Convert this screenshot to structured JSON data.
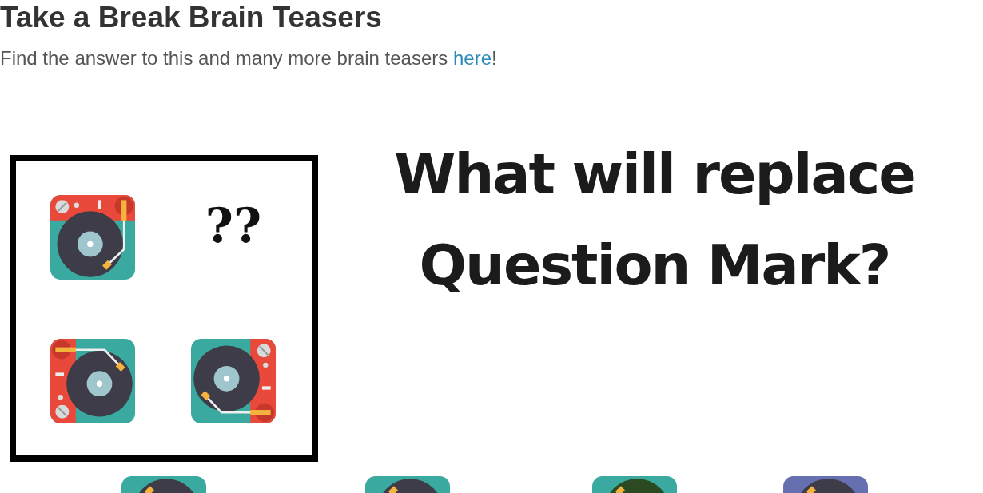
{
  "heading": "Take a Break Brain Teasers",
  "intro": {
    "before": "Find the answer to this and many more brain teasers ",
    "link": "here",
    "after": "!"
  },
  "puzzle": {
    "cells": [
      {
        "kind": "redtop"
      },
      {
        "kind": "text",
        "text": "??"
      },
      {
        "kind": "redleft"
      },
      {
        "kind": "redright"
      }
    ],
    "question": [
      "What will replace",
      "Question Mark?"
    ],
    "options": [
      {
        "kind": "redbottom",
        "color": "#3aa99f",
        "disc": {
          "color": "#3d3c48"
        }
      },
      {
        "kind": "redbottom",
        "color": "#3aa99f",
        "disc": {
          "color": "#3d3c48"
        }
      },
      {
        "kind": "redbottom",
        "color": "#3aa99f",
        "disc": {
          "color": "#2b4a22"
        }
      },
      {
        "kind": "redbottom",
        "color": "#6670b0",
        "disc": {
          "color": "#3d3c48"
        }
      }
    ]
  }
}
